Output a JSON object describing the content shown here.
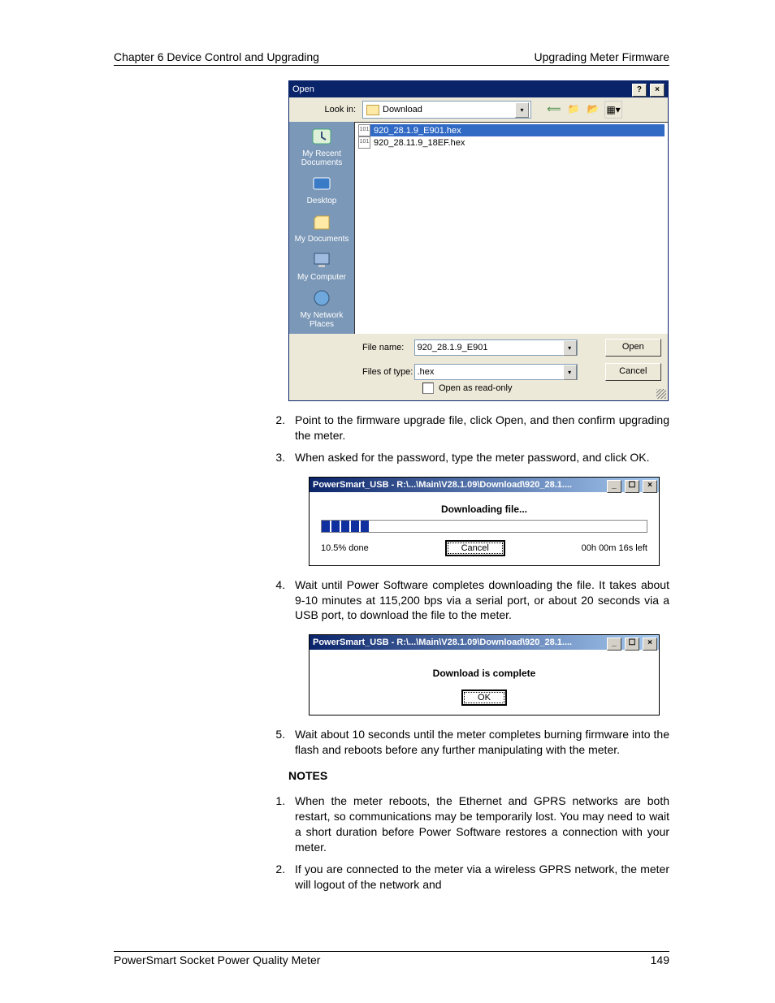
{
  "header": {
    "left": "Chapter 6 Device Control and Upgrading",
    "right": "Upgrading Meter Firmware"
  },
  "footer": {
    "left": "PowerSmart Socket Power Quality Meter",
    "right": "149"
  },
  "open_dialog": {
    "title": "Open",
    "help_label": "?",
    "close_label": "×",
    "look_in_label": "Look in:",
    "look_in_value": "Download",
    "places": [
      "My Recent Documents",
      "Desktop",
      "My Documents",
      "My Computer",
      "My Network Places"
    ],
    "files": [
      {
        "name": "920_28.1.9_E901.hex",
        "selected": true
      },
      {
        "name": "920_28.11.9_18EF.hex",
        "selected": false
      }
    ],
    "file_name_label": "File name:",
    "file_name_value": "920_28.1.9_E901",
    "file_type_label": "Files of type:",
    "file_type_value": ".hex",
    "readonly_label": "Open as read-only",
    "open_btn": "Open",
    "cancel_btn": "Cancel",
    "toolbar_icons": [
      "back-icon",
      "up-icon",
      "new-folder-icon",
      "views-icon"
    ]
  },
  "steps_a": [
    "Point to the firmware upgrade file, click Open, and then confirm upgrading the meter.",
    "When asked for the password, type the meter password, and click OK."
  ],
  "dl1": {
    "title": "PowerSmart_USB - R:\\...\\Main\\V28.1.09\\Download\\920_28.1....",
    "heading": "Downloading file...",
    "percent": "10.5% done",
    "cancel": "Cancel",
    "time_left": "00h 00m 16s left"
  },
  "step4": "Wait until Power Software completes downloading the file. It takes about 9-10 minutes at 115,200 bps via a serial port, or about 20 seconds via a USB port, to download the file to the meter.",
  "dl2": {
    "title": "PowerSmart_USB - R:\\...\\Main\\V28.1.09\\Download\\920_28.1....",
    "heading": "Download is complete",
    "ok": "OK"
  },
  "step5": "Wait about 10 seconds until the meter completes burning firmware into the flash and reboots before any further manipulating with the meter.",
  "notes_heading": "NOTES",
  "notes": [
    "When the meter reboots, the Ethernet and GPRS networks are both restart, so communications may be temporarily lost. You may need to wait a short duration before Power Software restores a connection with your meter.",
    "If you are connected to the meter via a wireless GPRS network, the meter will logout of the network and"
  ]
}
